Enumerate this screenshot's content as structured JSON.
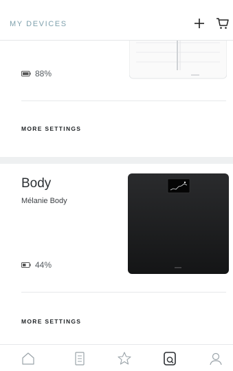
{
  "header": {
    "title": "MY DEVICES"
  },
  "devices": [
    {
      "battery": "88%",
      "more_settings": "MORE SETTINGS"
    },
    {
      "name": "Body",
      "owner": "Mélanie Body",
      "battery": "44%",
      "more_settings": "MORE SETTINGS"
    }
  ],
  "tabs": [
    "home-icon",
    "timeline-icon",
    "star-icon",
    "devices-icon",
    "profile-icon"
  ],
  "colors": {
    "header_title": "#7fa1ad",
    "background": "#eef0f1",
    "scale_black": "#1c1d1f"
  }
}
